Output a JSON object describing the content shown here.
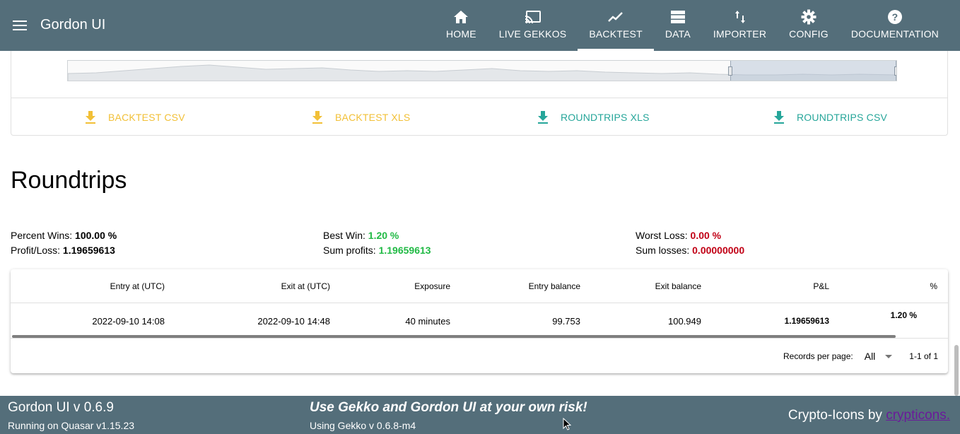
{
  "app": {
    "title": "Gordon UI"
  },
  "nav": [
    {
      "label": "HOME",
      "icon": "home-icon"
    },
    {
      "label": "LIVE GEKKOS",
      "icon": "cast-icon"
    },
    {
      "label": "BACKTEST",
      "icon": "trending-icon",
      "active": true
    },
    {
      "label": "DATA",
      "icon": "storage-icon"
    },
    {
      "label": "IMPORTER",
      "icon": "import-export-icon"
    },
    {
      "label": "CONFIG",
      "icon": "gear-icon"
    },
    {
      "label": "DOCUMENTATION",
      "icon": "help-icon"
    }
  ],
  "downloads": [
    {
      "label": "BACKTEST CSV",
      "color": "#f2c037"
    },
    {
      "label": "BACKTEST XLS",
      "color": "#f2c037"
    },
    {
      "label": "ROUNDTRIPS XLS",
      "color": "#26a69a"
    },
    {
      "label": "ROUNDTRIPS CSV",
      "color": "#26a69a"
    }
  ],
  "roundtrips": {
    "title": "Roundtrips",
    "stats": {
      "percent_wins_label": "Percent Wins:",
      "percent_wins": "100.00 %",
      "profit_loss_label": "Profit/Loss:",
      "profit_loss": "1.19659613",
      "best_win_label": "Best Win:",
      "best_win": "1.20 %",
      "sum_profits_label": "Sum profits:",
      "sum_profits": "1.19659613",
      "worst_loss_label": "Worst Loss:",
      "worst_loss": "0.00 %",
      "sum_losses_label": "Sum losses:",
      "sum_losses": "0.00000000"
    },
    "table": {
      "columns": [
        "Entry at (UTC)",
        "Exit at (UTC)",
        "Exposure",
        "Entry balance",
        "Exit balance",
        "P&L",
        "%"
      ],
      "rows": [
        [
          "2022-09-10 14:08",
          "2022-09-10 14:48",
          "40 minutes",
          "99.753",
          "100.949",
          "1.19659613",
          "1.20 %"
        ]
      ],
      "records_per_page_label": "Records per page:",
      "records_per_page": "All",
      "pagination": "1-1 of 1"
    }
  },
  "footer": {
    "title": "Gordon UI v 0.6.9",
    "running_on": "Running on Quasar v1.15.23",
    "warning": "Use Gekko and Gordon UI at your own risk!",
    "gekko_version": "Using Gekko v 0.6.8-m4",
    "credit_prefix": "Crypto-Icons by ",
    "credit_link": "crypticons."
  },
  "colors": {
    "header_bg": "#546e7a",
    "positive": "#21ba45",
    "negative": "#c10015",
    "download_yellow": "#f2c037",
    "download_teal": "#26a69a"
  }
}
